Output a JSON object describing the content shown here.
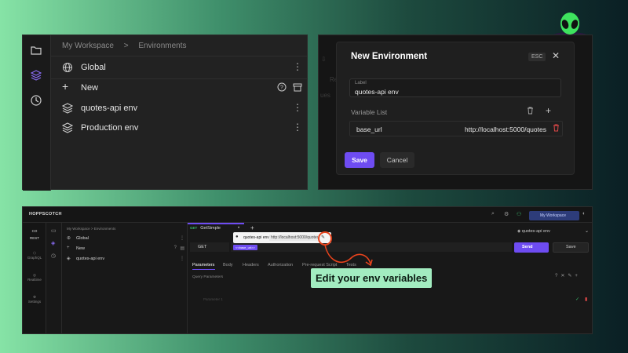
{
  "panel1": {
    "breadcrumb": [
      "My Workspace",
      ">",
      "Environments"
    ],
    "rows": [
      {
        "label": "Global"
      },
      {
        "label": "New"
      },
      {
        "label": "quotes-api env"
      },
      {
        "label": "Production env"
      }
    ],
    "more": "⋮"
  },
  "panel2": {
    "ghost1": "Re",
    "ghost2": "ues",
    "modal": {
      "title": "New Environment",
      "esc": "ESC",
      "close": "✕",
      "field_label": "Label",
      "field_value": "quotes-api env",
      "variable_list": "Variable List",
      "var_key": "base_url",
      "var_value": "http://localhost:5000/quotes",
      "save": "Save",
      "cancel": "Cancel"
    }
  },
  "panel3": {
    "brand": "HOPPSCOTCH",
    "workspace": "My Workspace",
    "rail": [
      {
        "code": "CO",
        "label": "REST"
      },
      {
        "code": "",
        "label": "GraphQL"
      },
      {
        "code": "",
        "label": "Realtime"
      },
      {
        "code": "",
        "label": "Settings"
      }
    ],
    "breadcrumb": "My Workspace  >  Environments",
    "env_rows": [
      "Global",
      "New",
      "quotes-api env"
    ],
    "tab_method": "GET",
    "tab_name": "GetSimple",
    "env_select": "quotes-api env",
    "method": "GET",
    "url_chip": "<<base_url>>",
    "send": "Send",
    "save": "Save",
    "param_tabs": [
      "Parameters",
      "Body",
      "Headers",
      "Authorization",
      "Pre-request Script",
      "Tests"
    ],
    "query_params": "Query Parameters",
    "param_placeholder": "Parameter 1"
  },
  "popup": {
    "env": "quotes-api env",
    "url": "http://localhost:5000/quotes"
  },
  "callout": "Edit your env variables",
  "colors": {
    "accent": "#6e4cf2",
    "danger": "#e04848",
    "callout_bg": "#a2ecc0",
    "highlight": "#e8431c"
  }
}
